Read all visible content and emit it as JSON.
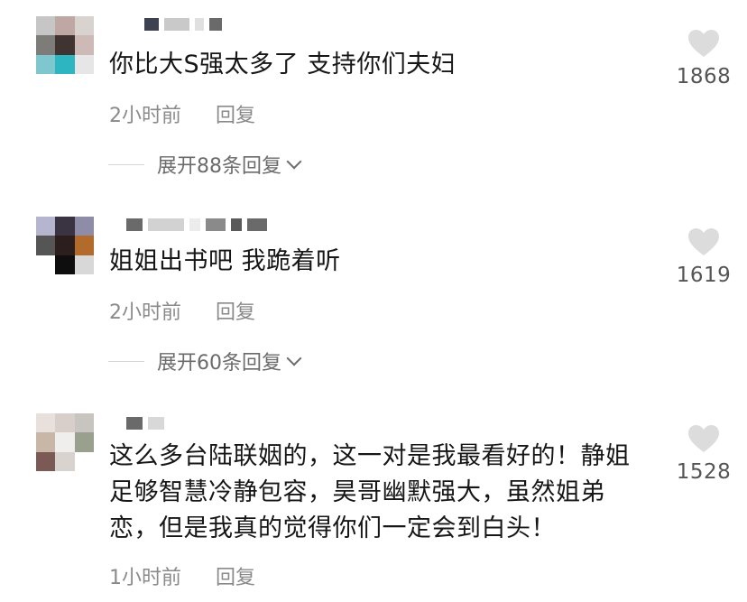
{
  "comments": [
    {
      "text": "你比大S强太多了 支持你们夫妇",
      "time": "2小时前",
      "reply_label": "回复",
      "expand_label": "展开88条回复",
      "likes": "1868",
      "avatar_colors": [
        "#c7c6c6",
        "#bfa7a4",
        "#d9d3d0",
        "#7e7c78",
        "#3f3432",
        "#cdb9b5",
        "#7fc7cf",
        "#2eb5c2",
        "#e6e6e6"
      ]
    },
    {
      "text": "姐姐出书吧 我跪着听",
      "time": "2小时前",
      "reply_label": "回复",
      "expand_label": "展开60条回复",
      "likes": "1619",
      "avatar_colors": [
        "#b6b5cf",
        "#3a3342",
        "#8f8ca8",
        "#555555",
        "#2b1e1c",
        "#b26b2a",
        "#ffffff",
        "#0e0e0e",
        "#d8d8d8"
      ]
    },
    {
      "text": "这么多台陆联姻的，这一对是我最看好的！静姐足够智慧冷静包容，昊哥幽默强大，虽然姐弟恋，但是我真的觉得你们一定会到白头！",
      "time": "1小时前",
      "reply_label": "回复",
      "likes": "1528",
      "avatar_colors": [
        "#e8e0dc",
        "#d8cfca",
        "#c8c5c0",
        "#c8b6a6",
        "#efeeec",
        "#9aa08e",
        "#7b5a55",
        "#d9d3cf",
        "#ffffff"
      ]
    }
  ],
  "colors": {
    "text": "#161616",
    "meta": "#8a8a8a",
    "heart": "#dcdcdc"
  }
}
